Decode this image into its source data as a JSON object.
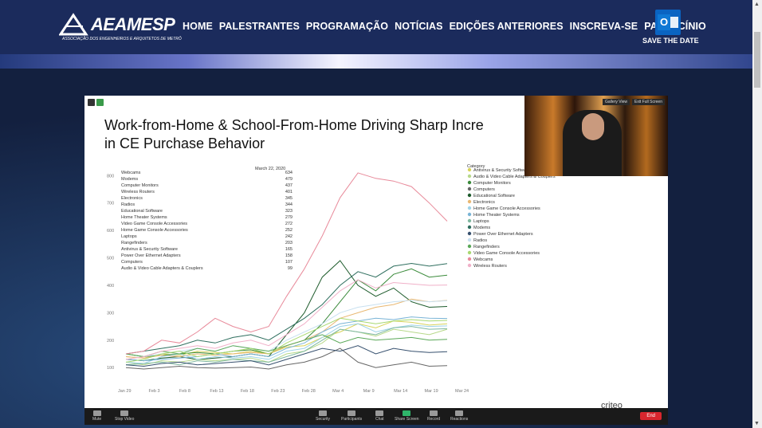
{
  "site": {
    "logo_text": "AEAMESP",
    "logo_sub": "ASSOCIAÇÃO DOS ENGENHEIROS E ARQUITETOS DE METRÔ",
    "menu": [
      "HOME",
      "PALESTRANTES",
      "PROGRAMAÇÃO",
      "NOTÍCIAS",
      "EDIÇÕES ANTERIORES",
      "INSCREVA-SE",
      "PATROCÍNIO"
    ],
    "save_the_date": "SAVE THE DATE",
    "outlook_letter": "O"
  },
  "slide": {
    "title_line1": "Work-from-Home & School-From-Home Driving Sharp Incre",
    "title_line2": "in CE Purchase Behavior",
    "brand": "criteo"
  },
  "video": {
    "gallery_view": "Gallery View",
    "exit_full_screen": "Exit Full Screen"
  },
  "zoom": {
    "buttons": [
      "Mute",
      "Stop Video",
      "Security",
      "Participants",
      "Chat",
      "Share Screen",
      "Record",
      "Reactions"
    ],
    "end_label": "End"
  },
  "chart_data": {
    "type": "line",
    "x_ticks": [
      "Jan 29",
      "Feb 3",
      "Feb 8",
      "Feb 13",
      "Feb 18",
      "Feb 23",
      "Feb 28",
      "Mar 4",
      "Mar 9",
      "Mar 14",
      "Mar 19",
      "Mar 24"
    ],
    "y_ticks": [
      100,
      200,
      300,
      400,
      500,
      600,
      700,
      800
    ],
    "ylim": [
      60,
      830
    ],
    "table_header": "March 22, 2020",
    "table": [
      {
        "name": "Webcams",
        "value": 634
      },
      {
        "name": "Modems",
        "value": 479
      },
      {
        "name": "Computer Monitors",
        "value": 437
      },
      {
        "name": "Wireless Routers",
        "value": 401
      },
      {
        "name": "Electronics",
        "value": 345
      },
      {
        "name": "Radios",
        "value": 344
      },
      {
        "name": "Educational Software",
        "value": 323
      },
      {
        "name": "Home Theater Systems",
        "value": 279
      },
      {
        "name": "Video Game Console Accessories",
        "value": 272
      },
      {
        "name": "Home Game Console Accessories",
        "value": 252
      },
      {
        "name": "Laptops",
        "value": 242
      },
      {
        "name": "Rangefinders",
        "value": 203
      },
      {
        "name": "Antivirus & Security Software",
        "value": 165
      },
      {
        "name": "Power Over Ethernet Adapters",
        "value": 158
      },
      {
        "name": "Computers",
        "value": 107
      },
      {
        "name": "Audio & Video Cable Adapters & Couplers",
        "value": 99
      }
    ],
    "legend_title": "Category",
    "series": [
      {
        "name": "Antivirus & Security Software",
        "color": "#d8d35a",
        "values": [
          140,
          135,
          150,
          145,
          160,
          155,
          150,
          160,
          150,
          175,
          180,
          210,
          230,
          260,
          245,
          270,
          265,
          255,
          260
        ]
      },
      {
        "name": "Audio & Video Cable Adapters & Couplers",
        "color": "#b7d98a",
        "values": [
          120,
          110,
          125,
          120,
          130,
          125,
          130,
          135,
          120,
          150,
          160,
          190,
          240,
          230,
          215,
          240,
          230,
          220,
          240
        ]
      },
      {
        "name": "Computer Monitors",
        "color": "#3a8a3a",
        "values": [
          150,
          140,
          145,
          150,
          155,
          150,
          160,
          165,
          150,
          180,
          200,
          260,
          340,
          420,
          380,
          440,
          460,
          430,
          437
        ]
      },
      {
        "name": "Computers",
        "color": "#666666",
        "values": [
          100,
          95,
          100,
          105,
          100,
          98,
          100,
          102,
          95,
          110,
          120,
          140,
          170,
          120,
          100,
          110,
          120,
          105,
          107
        ]
      },
      {
        "name": "Educational Software",
        "color": "#1c5a2a",
        "values": [
          130,
          125,
          135,
          140,
          130,
          135,
          140,
          150,
          140,
          220,
          300,
          430,
          490,
          400,
          360,
          390,
          340,
          320,
          323
        ]
      },
      {
        "name": "Electronics",
        "color": "#e9b872",
        "values": [
          140,
          135,
          145,
          140,
          150,
          145,
          150,
          155,
          150,
          180,
          200,
          230,
          280,
          300,
          320,
          330,
          350,
          340,
          345
        ]
      },
      {
        "name": "Home Game Console Accessories",
        "color": "#9ed3e8",
        "values": [
          120,
          115,
          140,
          150,
          130,
          140,
          135,
          140,
          130,
          160,
          170,
          210,
          250,
          260,
          230,
          245,
          255,
          250,
          252
        ]
      },
      {
        "name": "Home Theater Systems",
        "color": "#79b4d6",
        "values": [
          130,
          125,
          130,
          135,
          140,
          150,
          140,
          150,
          140,
          170,
          190,
          230,
          260,
          270,
          280,
          275,
          285,
          280,
          279
        ]
      },
      {
        "name": "Laptops",
        "color": "#7fb8a0",
        "values": [
          110,
          115,
          120,
          110,
          125,
          120,
          130,
          125,
          120,
          140,
          160,
          200,
          240,
          230,
          220,
          245,
          250,
          240,
          242
        ]
      },
      {
        "name": "Modems",
        "color": "#2e6e5e",
        "values": [
          150,
          160,
          170,
          180,
          200,
          190,
          210,
          220,
          200,
          240,
          280,
          330,
          400,
          450,
          430,
          470,
          480,
          470,
          479
        ]
      },
      {
        "name": "Power Over Ethernet Adapters",
        "color": "#36506e",
        "values": [
          110,
          105,
          115,
          120,
          110,
          115,
          120,
          125,
          110,
          130,
          150,
          170,
          160,
          180,
          150,
          170,
          160,
          155,
          158
        ]
      },
      {
        "name": "Radios",
        "color": "#c8e0f0",
        "values": [
          130,
          140,
          150,
          160,
          170,
          160,
          180,
          170,
          160,
          200,
          230,
          260,
          300,
          320,
          330,
          340,
          345,
          340,
          344
        ]
      },
      {
        "name": "Rangefinders",
        "color": "#5aa858",
        "values": [
          150,
          140,
          160,
          150,
          170,
          160,
          180,
          170,
          160,
          180,
          200,
          220,
          190,
          210,
          200,
          205,
          210,
          200,
          203
        ]
      },
      {
        "name": "Video Game Console Accessories",
        "color": "#a8d870",
        "values": [
          120,
          130,
          150,
          160,
          140,
          150,
          160,
          170,
          150,
          190,
          220,
          250,
          280,
          270,
          260,
          270,
          275,
          270,
          272
        ]
      },
      {
        "name": "Webcams",
        "color": "#e88a9a",
        "values": [
          150,
          160,
          200,
          190,
          230,
          280,
          250,
          230,
          250,
          360,
          460,
          580,
          720,
          810,
          790,
          780,
          760,
          700,
          634
        ]
      },
      {
        "name": "Wireless Routers",
        "color": "#f0b0c8",
        "values": [
          130,
          140,
          160,
          170,
          180,
          170,
          190,
          200,
          180,
          220,
          260,
          320,
          380,
          420,
          390,
          410,
          405,
          400,
          401
        ]
      }
    ]
  }
}
